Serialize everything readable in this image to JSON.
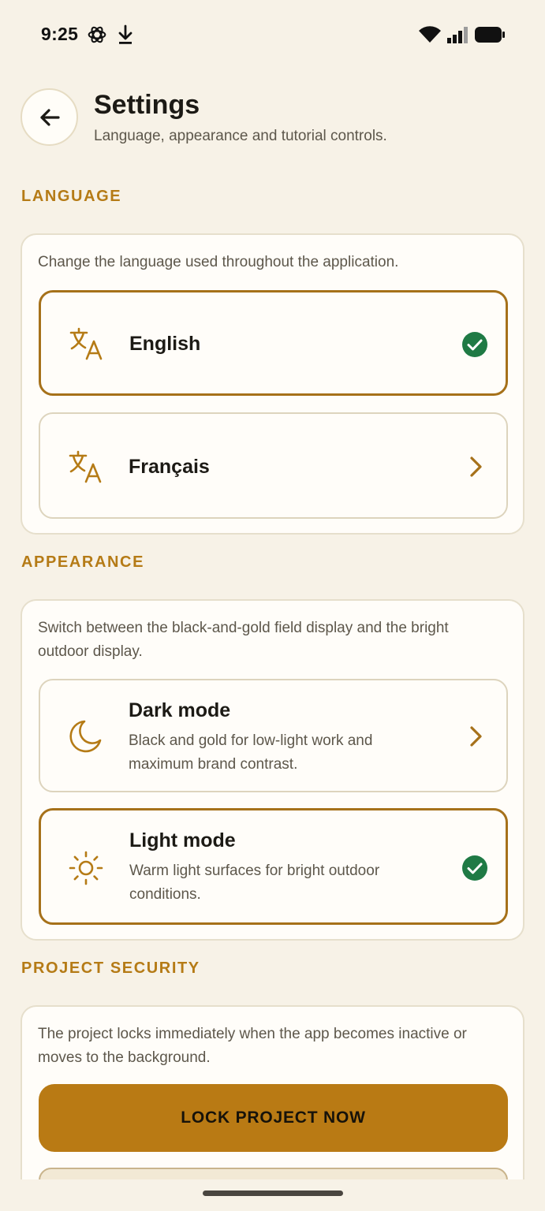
{
  "status_bar": {
    "time": "9:25",
    "icons": [
      "openai-icon",
      "download-icon",
      "wifi-icon",
      "signal-icon",
      "battery-icon"
    ]
  },
  "header": {
    "back_icon": "arrow-left-icon",
    "title": "Settings",
    "subtitle": "Language, appearance and tutorial controls."
  },
  "language": {
    "section_title": "LANGUAGE",
    "description": "Change the language used throughout the application.",
    "options": [
      {
        "label": "English",
        "icon": "translate-icon",
        "selected": true,
        "end_icon": "check-circle-icon"
      },
      {
        "label": "Français",
        "icon": "translate-icon",
        "selected": false,
        "end_icon": "chevron-right-icon"
      }
    ]
  },
  "appearance": {
    "section_title": "APPEARANCE",
    "description": "Switch between the black-and-gold field display and the bright outdoor display.",
    "options": [
      {
        "label": "Dark mode",
        "description": "Black and gold for low-light work and maximum brand contrast.",
        "icon": "moon-icon",
        "selected": false,
        "end_icon": "chevron-right-icon"
      },
      {
        "label": "Light mode",
        "description": "Warm light surfaces for bright outdoor conditions.",
        "icon": "sun-icon",
        "selected": true,
        "end_icon": "check-circle-icon"
      }
    ]
  },
  "project_security": {
    "section_title": "PROJECT SECURITY",
    "description": "The project locks immediately when the app becomes inactive or moves to the background.",
    "lock_button_label": "LOCK PROJECT NOW"
  },
  "colors": {
    "background": "#f7f2e7",
    "accent": "#b57b16",
    "button": "#b97a14",
    "check": "#1f7a45"
  }
}
